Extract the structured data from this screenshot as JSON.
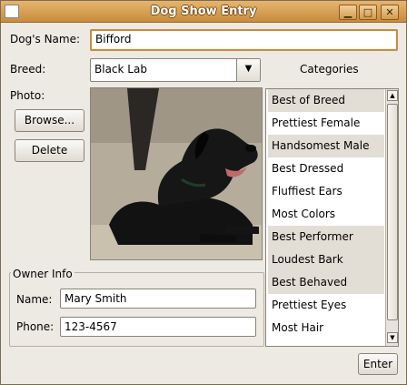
{
  "window": {
    "title": "Dog Show Entry",
    "controls": {
      "minimize": "▁",
      "maximize": "□",
      "close": "✕"
    }
  },
  "form": {
    "dogs_name_label": "Dog's Name:",
    "dogs_name_value": "Bifford",
    "breed_label": "Breed:",
    "breed_value": "Black Lab",
    "photo_label": "Photo:",
    "browse_button": "Browse...",
    "delete_button": "Delete",
    "enter_button": "Enter"
  },
  "owner": {
    "group_label": "Owner Info",
    "name_label": "Name:",
    "name_value": "Mary Smith",
    "phone_label": "Phone:",
    "phone_value": "123-4567"
  },
  "categories": {
    "label": "Categories",
    "items": [
      {
        "label": "Best of Breed",
        "selected": true
      },
      {
        "label": "Prettiest Female",
        "selected": false
      },
      {
        "label": "Handsomest Male",
        "selected": true
      },
      {
        "label": "Best Dressed",
        "selected": false
      },
      {
        "label": "Fluffiest Ears",
        "selected": false
      },
      {
        "label": "Most Colors",
        "selected": false
      },
      {
        "label": "Best Performer",
        "selected": true
      },
      {
        "label": "Loudest Bark",
        "selected": true
      },
      {
        "label": "Best Behaved",
        "selected": true
      },
      {
        "label": "Prettiest Eyes",
        "selected": false
      },
      {
        "label": "Most Hair",
        "selected": false
      }
    ]
  },
  "icons": {
    "combo_arrow": "▼",
    "scroll_up": "▲",
    "scroll_down": "▼",
    "photo": "dog-photo-icon"
  }
}
